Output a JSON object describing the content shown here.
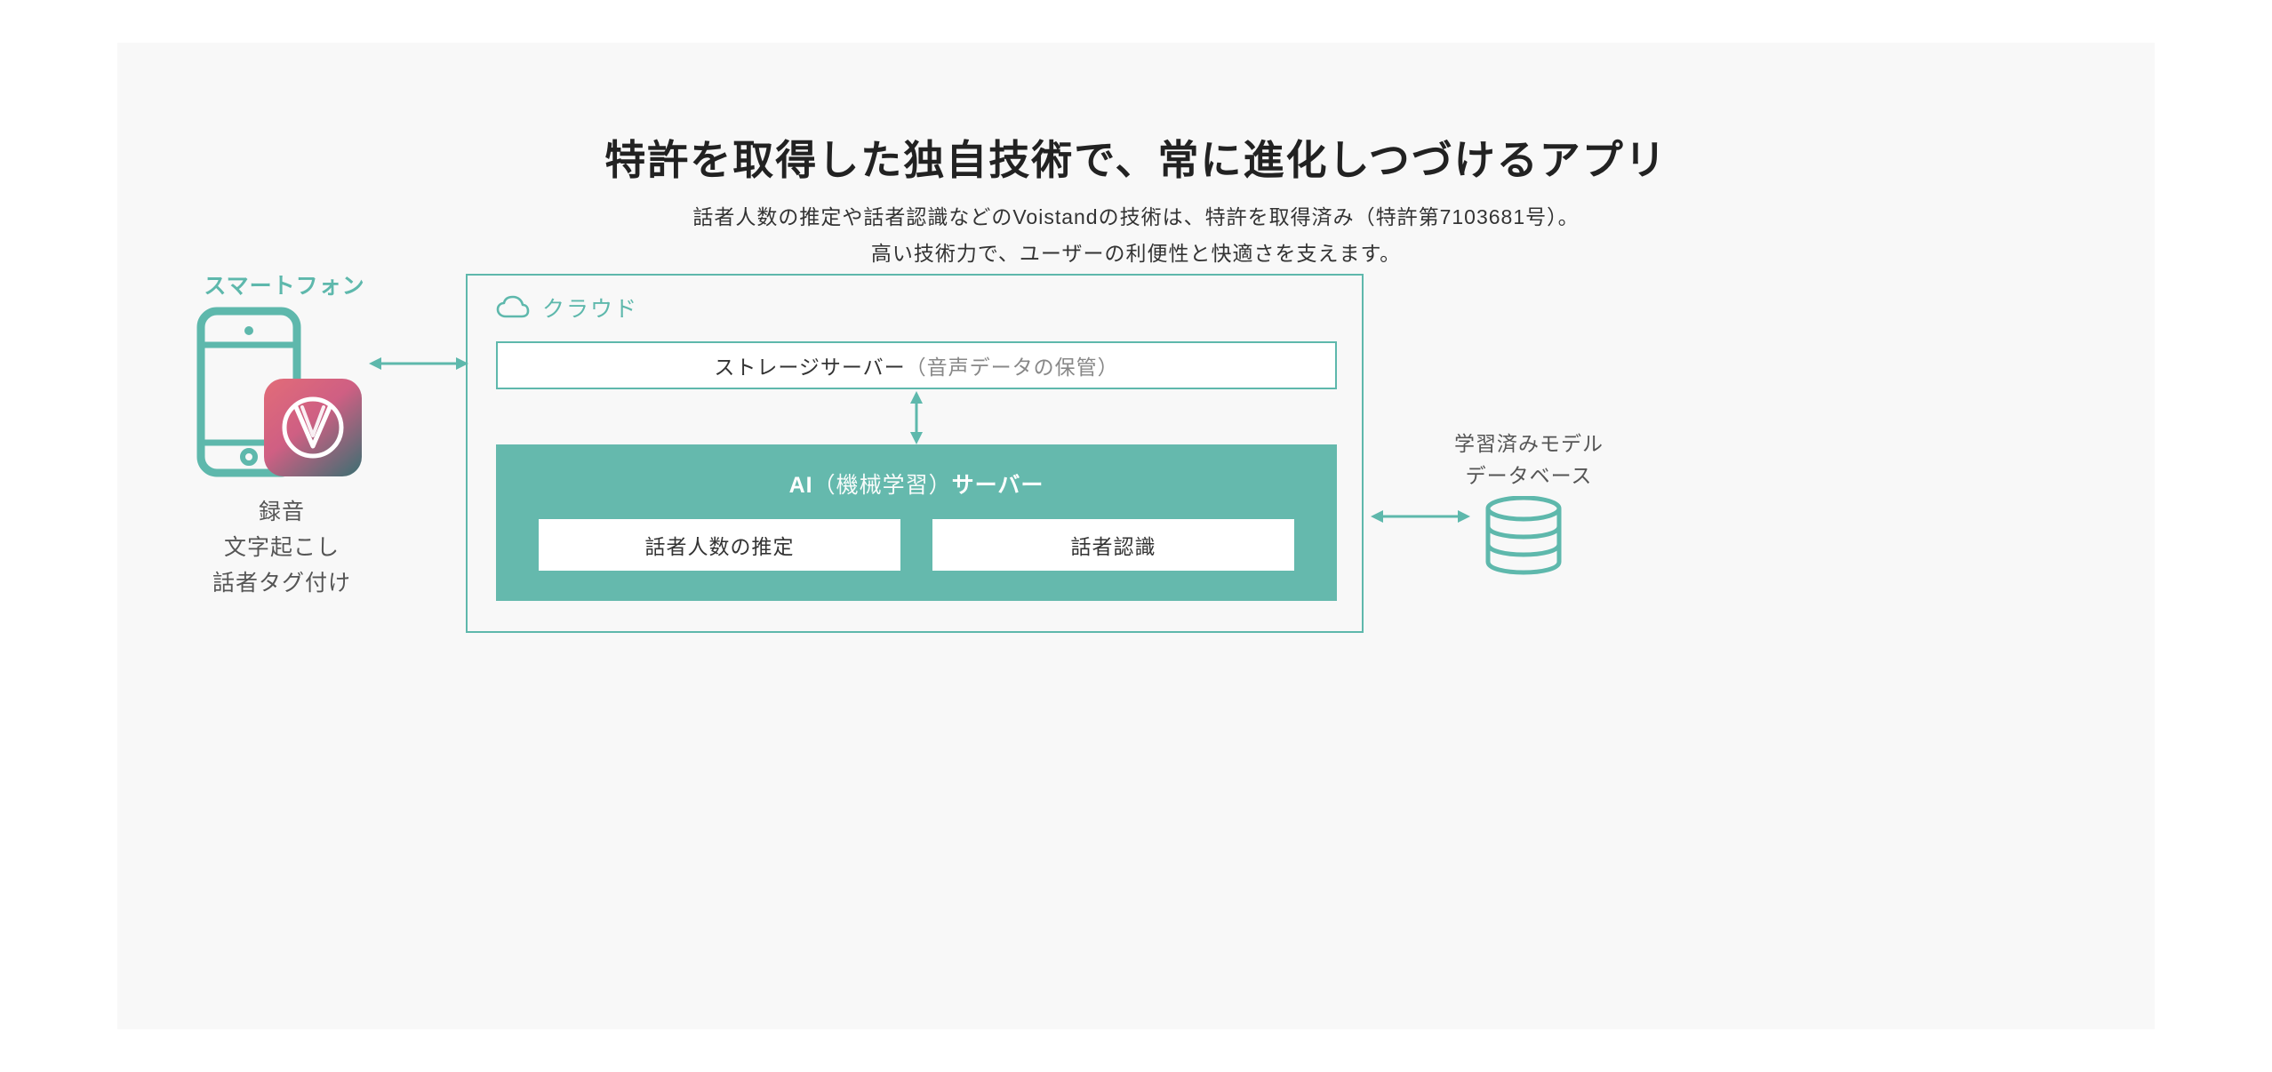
{
  "title": "特許を取得した独自技術で、常に進化しつづけるアプリ",
  "description_line1": "話者人数の推定や話者認識などのVoistandの技術は、特許を取得済み（特許第7103681号）。",
  "description_line2": "高い技術力で、ユーザーの利便性と快適さを支えます。",
  "smartphone": {
    "label": "スマートフォン",
    "captions": [
      "録音",
      "文字起こし",
      "話者タグ付け"
    ]
  },
  "cloud": {
    "label": "クラウド",
    "storage": {
      "title": "ストレージサーバー",
      "subtitle": "（音声データの保管）"
    },
    "ai": {
      "title_prefix": "AI",
      "title_sub": "（機械学習）",
      "title_suffix": "サーバー",
      "boxes": [
        "話者人数の推定",
        "話者認識"
      ]
    }
  },
  "database": {
    "caption_line1": "学習済みモデル",
    "caption_line2": "データベース"
  },
  "colors": {
    "teal": "#5eb8ac",
    "teal_fill": "#65b9ad",
    "panel_bg": "#f8f8f8"
  }
}
